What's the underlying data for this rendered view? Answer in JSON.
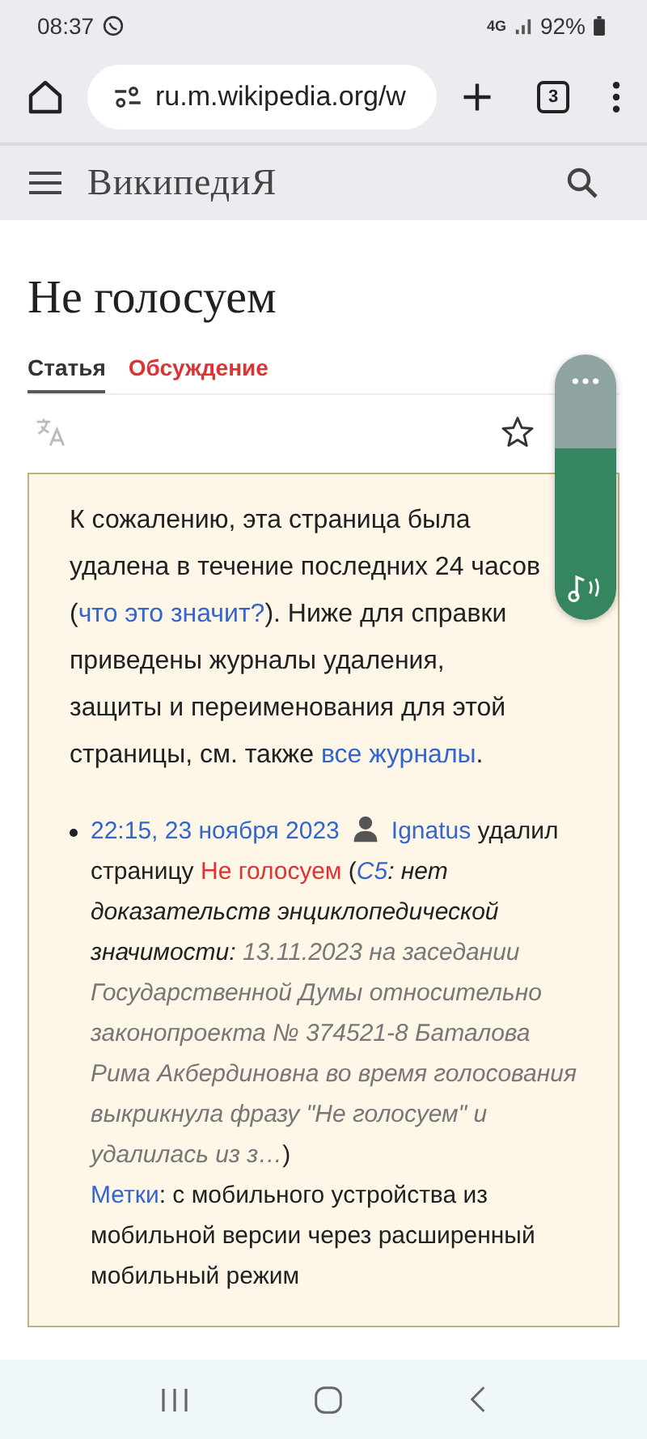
{
  "status_bar": {
    "time": "08:37",
    "network": "4G",
    "battery": "92%"
  },
  "browser": {
    "url": "ru.m.wikipedia.org/w",
    "tab_count": "3"
  },
  "header": {
    "logo": "ВикипедиЯ"
  },
  "page": {
    "title": "Не голосуем",
    "tabs": [
      {
        "label": "Статья",
        "selected": true
      },
      {
        "label": "Обсуждение",
        "selected": false
      }
    ],
    "notice": [
      {
        "kind": "text",
        "text": "К сожалению, эта страница была удалена в течение последних 24 часов ("
      },
      {
        "kind": "link",
        "text": "что это значит?"
      },
      {
        "kind": "text",
        "text": "). Ниже для справки приведены журналы удаления, защиты и переименования для этой страницы, см. также "
      },
      {
        "kind": "link",
        "text": "все журналы"
      },
      {
        "kind": "text",
        "text": "."
      }
    ],
    "log_entry": [
      {
        "kind": "link",
        "text": "22:15, 23 ноября 2023"
      },
      {
        "kind": "user"
      },
      {
        "kind": "link",
        "text": "Ignatus"
      },
      {
        "kind": "text",
        "text": " удалил страницу "
      },
      {
        "kind": "redlink",
        "text": "Не голосуем"
      },
      {
        "kind": "text",
        "text": " ("
      },
      {
        "kind": "italiclink",
        "text": "С5"
      },
      {
        "kind": "italic",
        "text": ": нет доказательств энциклопедической значимости: "
      },
      {
        "kind": "comment",
        "text": "13.11.2023 на заседании Государственной Думы относительно законопроекта № 374521-8 Баталова Рима Акбердиновна во время голосования выкрикнула фразу \"Не голосуем\" и удалилась из з…"
      },
      {
        "kind": "text",
        "text": ")"
      },
      {
        "kind": "break"
      },
      {
        "kind": "link",
        "text": "Метки"
      },
      {
        "kind": "text",
        "text": ": с мобильного устройства из мобильной версии через расширенный мобильный режим"
      }
    ]
  }
}
